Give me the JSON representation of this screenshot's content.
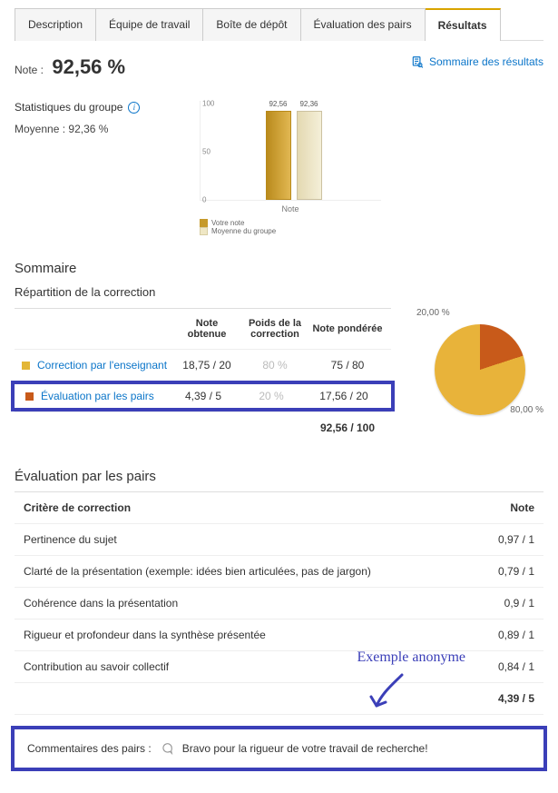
{
  "tabs": {
    "t0": "Description",
    "t1": "Équipe de travail",
    "t2": "Boîte de dépôt",
    "t3": "Évaluation des pairs",
    "t4": "Résultats"
  },
  "note": {
    "label": "Note :",
    "value": "92,56 %"
  },
  "summary_link": "Sommaire des résultats",
  "stats": {
    "title": "Statistiques du groupe",
    "avg_label": "Moyenne :",
    "avg_value": "92,36 %"
  },
  "chart_data": {
    "type": "bar",
    "categories": [
      "Votre note",
      "Moyenne du groupe"
    ],
    "values": [
      92.56,
      92.36
    ],
    "labels": [
      "92,56",
      "92,36"
    ],
    "title": "",
    "xlabel": "Note",
    "ylabel": "",
    "ylim": [
      0,
      100
    ],
    "yticks": [
      "0",
      "50",
      "100"
    ],
    "legend": [
      "Votre note",
      "Moyenne du groupe"
    ]
  },
  "sommaire_title": "Sommaire",
  "repartition_title": "Répartition de la correction",
  "rep_headers": {
    "h1": "",
    "h2": "Note obtenue",
    "h3": "Poids de la correction",
    "h4": "Note pondérée"
  },
  "rep_rows": [
    {
      "label": "Correction par l'enseignant",
      "obt": "18,75 / 20",
      "poids": "80 %",
      "pond": "75 / 80"
    },
    {
      "label": "Évaluation par les pairs",
      "obt": "4,39 / 5",
      "poids": "20 %",
      "pond": "17,56 / 20"
    }
  ],
  "rep_total": "92,56 / 100",
  "pie": {
    "type": "pie",
    "slices": [
      {
        "label": "20,00 %",
        "value": 20.0
      },
      {
        "label": "80,00 %",
        "value": 80.0
      }
    ]
  },
  "eval_title": "Évaluation par les pairs",
  "crit_headers": {
    "left": "Critère de correction",
    "right": "Note"
  },
  "criteria": [
    {
      "label": "Pertinence du sujet",
      "score": "0,97 / 1"
    },
    {
      "label": "Clarté de la présentation (exemple: idées bien articulées, pas de jargon)",
      "score": "0,79 / 1"
    },
    {
      "label": "Cohérence dans la présentation",
      "score": "0,9 / 1"
    },
    {
      "label": "Rigueur et profondeur dans la synthèse présentée",
      "score": "0,89 / 1"
    },
    {
      "label": "Contribution au savoir collectif",
      "score": "0,84 / 1"
    }
  ],
  "crit_total": "4,39 / 5",
  "annotation": "Exemple anonyme",
  "comment": {
    "label": "Commentaires des pairs :",
    "text": "Bravo pour la rigueur de votre travail de recherche!"
  }
}
